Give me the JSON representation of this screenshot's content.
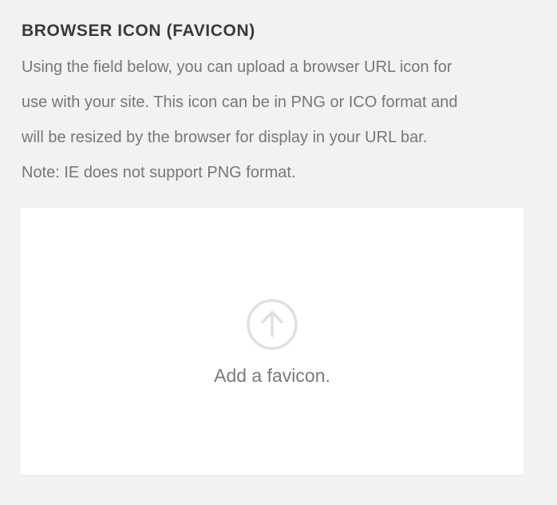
{
  "section": {
    "title": "BROWSER ICON (FAVICON)",
    "description_lines": [
      "Using the field below, you can upload a browser URL icon for",
      "use with your site. This icon can be in PNG or ICO format and",
      "will be resized by the browser for display in your URL bar.",
      "Note: IE does not support PNG format."
    ]
  },
  "upload": {
    "icon": "arrow-up-circle-icon",
    "label": "Add a favicon."
  },
  "colors": {
    "background": "#f2f2f2",
    "title": "#3a3a3a",
    "body_text": "#777777",
    "upload_bg": "#ffffff",
    "icon_stroke": "#e0e0e0"
  }
}
